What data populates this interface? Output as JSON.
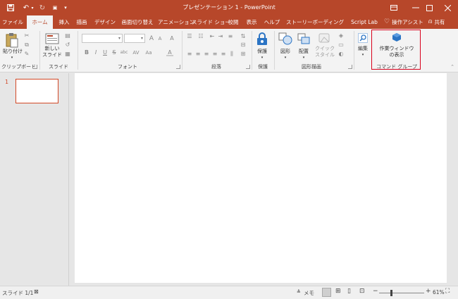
{
  "window": {
    "title": "プレゼンテーション 1 - PowerPoint",
    "quick_access": {
      "save_icon": "save-icon",
      "undo_icon": "undo-icon",
      "redo_icon": "redo-icon",
      "customize_icon": "customize-icon"
    },
    "controls": {
      "restore": "▭",
      "minimize": "—",
      "maximize": "☐",
      "close": "✕"
    }
  },
  "tabs": [
    {
      "label": "ファイル",
      "active": false
    },
    {
      "label": "ホーム",
      "active": true
    },
    {
      "label": "挿入",
      "active": false
    },
    {
      "label": "描画",
      "active": false
    },
    {
      "label": "デザイン",
      "active": false
    },
    {
      "label": "画面切り替え",
      "active": false
    },
    {
      "label": "アニメーション",
      "active": false
    },
    {
      "label": "スライド ショー",
      "active": false
    },
    {
      "label": "校閲",
      "active": false
    },
    {
      "label": "表示",
      "active": false
    },
    {
      "label": "ヘルプ",
      "active": false
    },
    {
      "label": "ストーリーボーディング",
      "active": false
    },
    {
      "label": "Script Lab",
      "active": false
    }
  ],
  "tell_me": "操作アシスト",
  "share": "共有",
  "ribbon": {
    "clipboard": {
      "paste": "貼り付け",
      "group": "クリップボード"
    },
    "slides": {
      "new_slide_line1": "新しい",
      "new_slide_line2": "スライド",
      "group": "スライド"
    },
    "font": {
      "group": "フォント",
      "bold": "B",
      "italic": "I",
      "underline": "U",
      "strike": "S",
      "shadow": "abc",
      "spacing": "AV",
      "case": "Aa",
      "grow": "A",
      "shrink": "A",
      "clear": "A",
      "color": "A"
    },
    "paragraph": {
      "group": "段落"
    },
    "protection": {
      "label": "保護",
      "group": "保護"
    },
    "drawing": {
      "shapes": "図形",
      "arrange": "配置",
      "quick_styles_line1": "クイック",
      "quick_styles_line2": "スタイル",
      "group": "図形描画"
    },
    "editing": {
      "label": "編集"
    },
    "taskpane": {
      "line1": "作業ウィンドウ",
      "line2": "の表示",
      "group": "コマンド グループ"
    }
  },
  "thumbnails": [
    {
      "number": "1"
    }
  ],
  "status": {
    "slide_counter": "スライド 1/1",
    "notes": "メモ",
    "zoom_minus": "−",
    "zoom_plus": "+",
    "zoom_level": "61%",
    "zoom_value": 0.61
  },
  "colors": {
    "accent": "#b7472a",
    "selection": "#d24726",
    "highlight": "#d9001b",
    "protect_blue": "#2b74c4"
  }
}
